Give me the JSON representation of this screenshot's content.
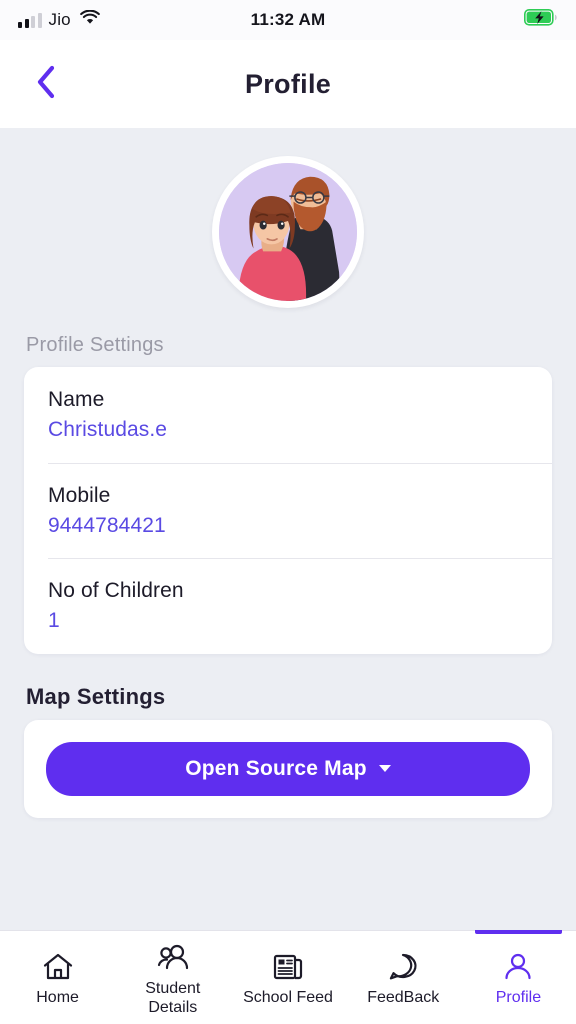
{
  "status_bar": {
    "carrier": "Jio",
    "time": "11:32 AM",
    "signal_bars_filled": 2,
    "signal_bars_total": 4,
    "wifi_icon": "wifi-icon",
    "battery_icon": "battery-charging-icon",
    "battery_color": "#2ECC55"
  },
  "header": {
    "back_icon": "chevron-left-icon",
    "title": "Profile",
    "accent_color": "#5F2EEF"
  },
  "avatar": {
    "icon": "couple-avatar",
    "background_color": "#D7C9F2"
  },
  "profile_settings": {
    "section_title": "Profile Settings",
    "rows": [
      {
        "label": "Name",
        "value": "Christudas.e"
      },
      {
        "label": "Mobile",
        "value": "9444784421"
      },
      {
        "label": "No of Children",
        "value": "1"
      }
    ]
  },
  "map_settings": {
    "section_title": "Map Settings",
    "button_label": "Open Source Map",
    "button_color": "#5F2EEF",
    "dropdown_icon": "caret-down-icon"
  },
  "bottom_nav": {
    "items": [
      {
        "label": "Home",
        "icon": "home-icon",
        "active": false
      },
      {
        "label": "Student\nDetails",
        "label_line1": "Student",
        "label_line2": "Details",
        "icon": "users-icon",
        "active": false
      },
      {
        "label": "School Feed",
        "icon": "newspaper-icon",
        "active": false
      },
      {
        "label": "FeedBack",
        "icon": "speech-bubble-icon",
        "active": false
      },
      {
        "label": "Profile",
        "icon": "person-icon",
        "active": true
      }
    ],
    "active_color": "#5F2EEF",
    "inactive_color": "#1D1B29"
  }
}
